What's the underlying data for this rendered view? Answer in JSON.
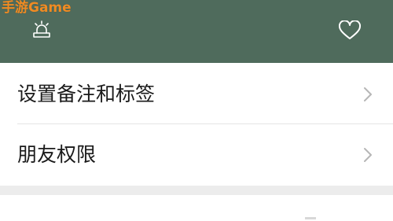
{
  "watermark": {
    "text": "手游Game"
  },
  "header": {
    "background": "#4f6b5c",
    "left_icon": "alarm-light-icon",
    "right_icon": "heart-outline-icon"
  },
  "menu": {
    "items": [
      {
        "label": "设置备注和标签",
        "icon": "chevron-right-icon"
      },
      {
        "label": "朋友权限",
        "icon": "chevron-right-icon"
      }
    ]
  }
}
